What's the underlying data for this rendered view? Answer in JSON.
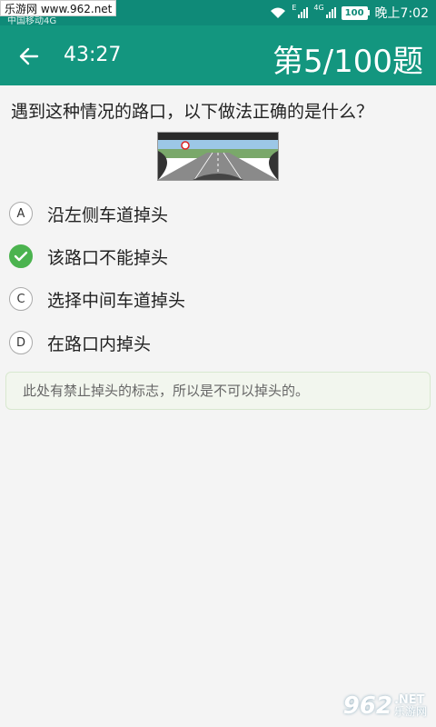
{
  "status_bar": {
    "watermark": "乐游网 www.962.net",
    "carrier": "中国移动4G",
    "network_e": "E",
    "network_4g": "4G",
    "battery": "100",
    "time": "晚上7:02"
  },
  "app_bar": {
    "timer": "43:27",
    "progress": "第5/100题",
    "back_icon": "arrow-left-icon"
  },
  "question": {
    "text": "遇到这种情况的路口，以下做法正确的是什么？",
    "options": [
      {
        "letter": "A",
        "text": "沿左侧车道掉头",
        "state": "normal"
      },
      {
        "letter": "",
        "text": "该路口不能掉头",
        "state": "correct"
      },
      {
        "letter": "C",
        "text": "选择中间车道掉头",
        "state": "normal"
      },
      {
        "letter": "D",
        "text": "在路口内掉头",
        "state": "normal"
      }
    ],
    "explanation": "此处有禁止掉头的标志，所以是不可以掉头的。"
  },
  "branding": {
    "number": "962",
    "net": ".NET",
    "name": "乐游网"
  },
  "colors": {
    "primary": "#13967f",
    "status": "#0f8a78",
    "correct": "#4bb34f"
  }
}
